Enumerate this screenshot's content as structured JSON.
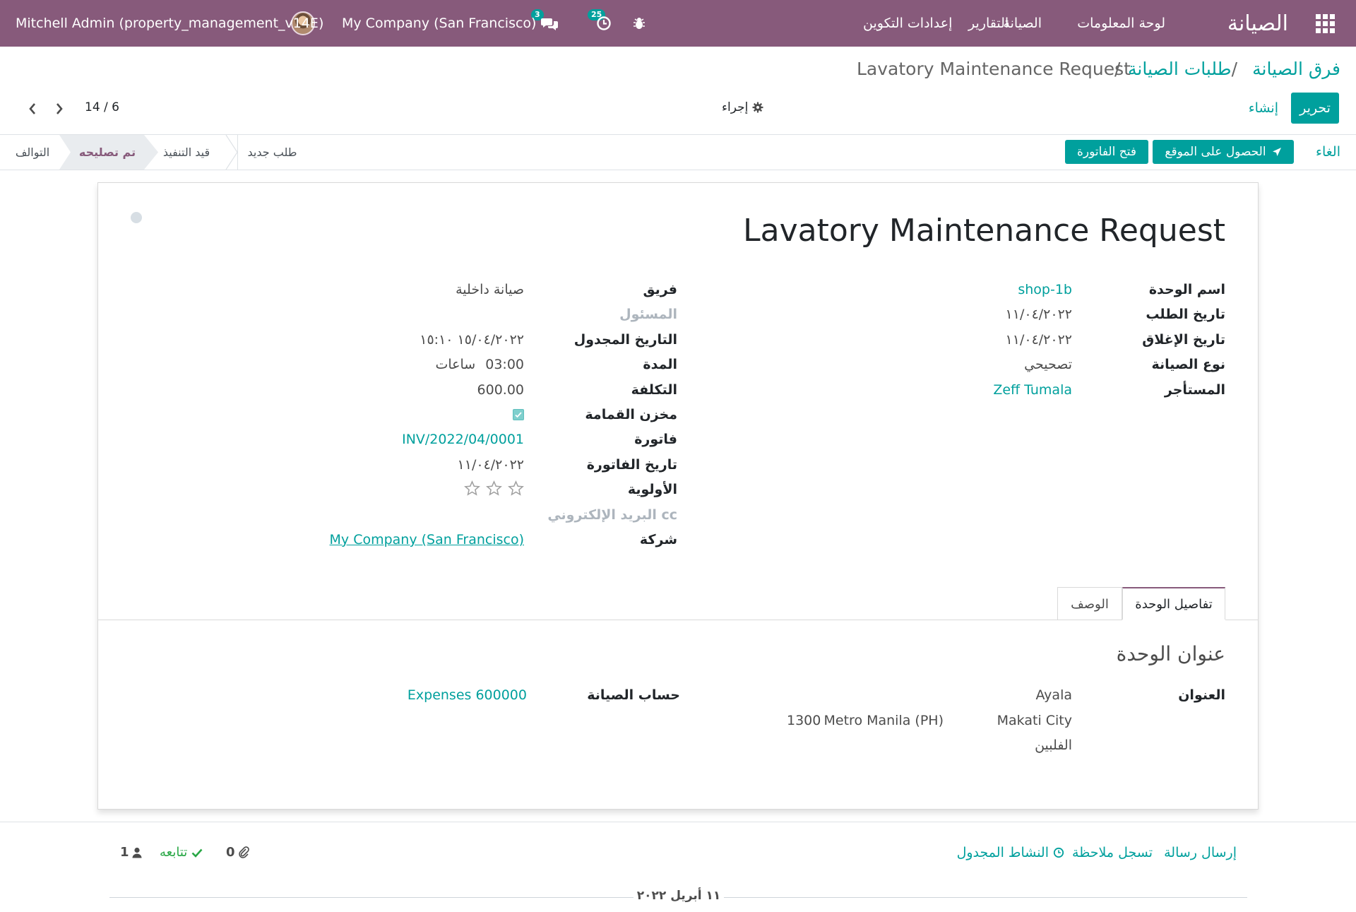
{
  "navbar": {
    "brand": "الصيانة",
    "menu": [
      "لوحة المعلومات",
      "الصيانة",
      "التقارير",
      "إعدادات التكوين"
    ],
    "bug_icon": "bug-icon",
    "activities_count": "25",
    "messages_count": "3",
    "company": "My Company (San Francisco)",
    "user": "Mitchell Admin (property_management_v14E)"
  },
  "breadcrumb": {
    "items": [
      "فرق الصيانة",
      "طلبات الصيانة"
    ],
    "separator": "/",
    "current": "Lavatory Maintenance Request"
  },
  "toolbar": {
    "edit": "تحرير",
    "create": "إنشاء",
    "action": "إجراء",
    "pager": "14 / 6"
  },
  "statusbar": {
    "buttons": {
      "cancel": "الغاء",
      "get_location": "الحصول على الموقع",
      "open_invoice": "فتح الفاتورة"
    },
    "stages": [
      "طلب جديد",
      "قيد التنفيذ",
      "تم تصليحه",
      "التوالف"
    ],
    "active_stage": "تم تصليحه"
  },
  "form": {
    "title": "Lavatory Maintenance Request",
    "right_fields": [
      {
        "label": "اسم الوحدة",
        "value": "shop-1b"
      },
      {
        "label": "تاريخ الطلب",
        "value": "١١/٠٤/٢٠٢٢"
      },
      {
        "label": "تاريخ الإغلاق",
        "value": "١١/٠٤/٢٠٢٢"
      },
      {
        "label": "نوع الصيانة",
        "value": "تصحيحي"
      },
      {
        "label": "المستأجر",
        "value": "Zeff Tumala"
      }
    ],
    "left_fields": {
      "team": {
        "label": "فريق",
        "value": "صيانة داخلية"
      },
      "responsible": {
        "label": "المسئول",
        "value": ""
      },
      "scheduled_date": {
        "label": "التاريخ المجدول",
        "value": "١٥/٠٤/٢٠٢٢ ١٥:١٠"
      },
      "duration": {
        "label": "المدة",
        "value": "03:00",
        "unit": "ساعات"
      },
      "cost": {
        "label": "التكلفة",
        "value": "600.00"
      },
      "scrap": {
        "label": "مخزن القمامة",
        "checked": true
      },
      "invoice": {
        "label": "فاتورة",
        "value": "INV/2022/04/0001"
      },
      "invoice_date": {
        "label": "تاريخ الفاتورة",
        "value": "١١/٠٤/٢٠٢٢"
      },
      "priority": {
        "label": "الأولوية",
        "stars": 3,
        "filled": 0
      },
      "email_cc": {
        "label": "البريد الإلكتروني cc",
        "value": ""
      },
      "company": {
        "label": "شركة",
        "value": "My Company (San Francisco)"
      }
    },
    "tabs": [
      "تفاصيل الوحدة",
      "الوصف"
    ],
    "active_tab": "تفاصيل الوحدة",
    "unit_address": {
      "heading": "عنوان الوحدة",
      "address_label": "العنوان",
      "street": "Ayala",
      "city": "Makati City",
      "state": "Metro Manila (PH)",
      "zip": "1300",
      "country": "الفلبين",
      "account_label": "حساب الصيانة",
      "account_value": "Expenses 600000"
    }
  },
  "chatter": {
    "send_message": "إرسال رسالة",
    "log_note": "تسجل ملاحظة",
    "schedule_activity": "النشاط المجدول",
    "attachments": "0",
    "follow": "تتابعه",
    "followers": "1",
    "date_separator": "١١ أبريل ٢٠٢٢"
  },
  "colors": {
    "brand": "#875a7b",
    "accent": "#00a09d"
  }
}
